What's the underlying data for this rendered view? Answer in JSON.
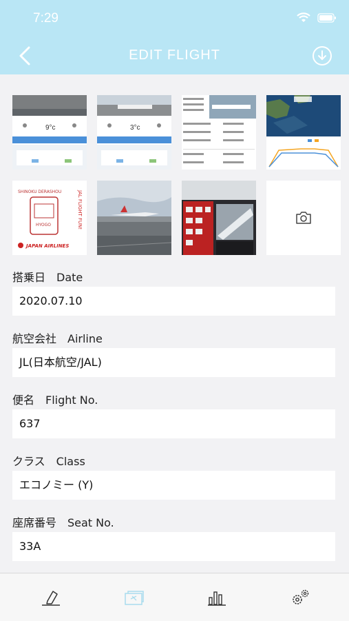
{
  "status_bar": {
    "time": "7:29"
  },
  "header": {
    "title": "EDIT FLIGHT"
  },
  "stamp": {
    "top_text": "SHINOKU DERASHOU",
    "side_text": "JAL FLIGHT FUN!",
    "mid_text": "HYOGO",
    "logo_text": "JAPAN AIRLINES"
  },
  "weather_card_1": {
    "temp": "9°c"
  },
  "weather_card_2": {
    "temp": "3°c"
  },
  "fields": {
    "date": {
      "label": "搭乗日　Date",
      "value": "2020.07.10"
    },
    "airline": {
      "label": "航空会社　Airline",
      "value": "JL(日本航空/JAL)"
    },
    "flight_no": {
      "label": "便名　Flight No.",
      "value": "637"
    },
    "class": {
      "label": "クラス　Class",
      "value": "エコノミー (Y)"
    },
    "seat_no": {
      "label": "座席番号　Seat No.",
      "value": "33A"
    }
  },
  "colors": {
    "header": "#b9e6f5",
    "accent": "#4a90d9"
  },
  "icons": [
    "back-chevron-icon",
    "download-icon",
    "camera-icon",
    "pen-icon",
    "ticket-icon",
    "bar-chart-icon",
    "gears-icon"
  ]
}
